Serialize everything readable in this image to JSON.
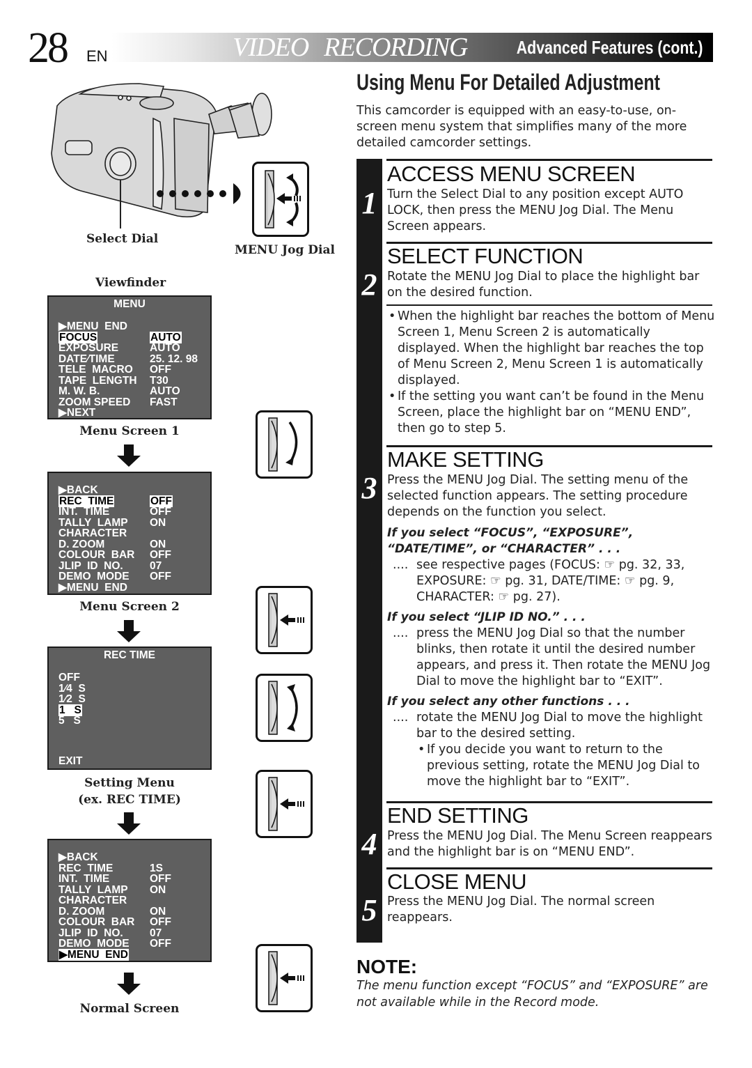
{
  "header": {
    "page_number": "28",
    "language": "EN",
    "title_part1": "VIDEO",
    "title_part2": "RECORDING",
    "title_part3": "Advanced Features (cont.)"
  },
  "section": {
    "title": "Using Menu For Detailed Adjustment",
    "intro": "This camcorder is equipped with an easy-to-use, on-screen menu system that simplifies many of the more detailed camcorder settings."
  },
  "illustration": {
    "select_dial_label": "Select Dial",
    "menu_jog_dial_label": "MENU Jog Dial",
    "viewfinder_label": "Viewfinder"
  },
  "menu_screen_1": {
    "title": "MENU",
    "caption": "Menu Screen 1",
    "rows": [
      {
        "label": "▶MENU  END",
        "value": ""
      },
      {
        "label": "FOCUS",
        "value": "AUTO",
        "highlight": true
      },
      {
        "label": "EXPOSURE",
        "value": "AUTO"
      },
      {
        "label": "DATE∕TIME",
        "value": "25. 12. 98"
      },
      {
        "label": "TELE  MACRO",
        "value": "OFF"
      },
      {
        "label": "TAPE  LENGTH",
        "value": "T30"
      },
      {
        "label": "M. W. B.",
        "value": "AUTO"
      },
      {
        "label": "ZOOM SPEED",
        "value": "FAST"
      },
      {
        "label": "▶NEXT",
        "value": ""
      }
    ]
  },
  "menu_screen_2": {
    "caption": "Menu Screen 2",
    "rows": [
      {
        "label": "▶BACK",
        "value": ""
      },
      {
        "label": "REC  TIME",
        "value": "OFF",
        "highlight": true
      },
      {
        "label": "INT.  TIME",
        "value": "OFF"
      },
      {
        "label": "TALLY  LAMP",
        "value": "ON"
      },
      {
        "label": "CHARACTER",
        "value": ""
      },
      {
        "label": "D. ZOOM",
        "value": "ON"
      },
      {
        "label": "COLOUR  BAR",
        "value": "OFF"
      },
      {
        "label": "JLIP  ID  NO.",
        "value": "07"
      },
      {
        "label": "DEMO  MODE",
        "value": "OFF"
      },
      {
        "label": "▶MENU  END",
        "value": ""
      }
    ]
  },
  "setting_menu": {
    "title": "REC  TIME",
    "caption_line1": "Setting Menu",
    "caption_line2": "(ex. REC TIME)",
    "options": [
      "OFF",
      "1∕4  S",
      "1∕2  S",
      "1   S",
      "5   S"
    ],
    "selected_index": 3,
    "exit_label": "EXIT"
  },
  "menu_screen_final": {
    "rows": [
      {
        "label": "▶BACK",
        "value": ""
      },
      {
        "label": "REC  TIME",
        "value": "1S"
      },
      {
        "label": "INT.  TIME",
        "value": "OFF"
      },
      {
        "label": "TALLY  LAMP",
        "value": "ON"
      },
      {
        "label": "CHARACTER",
        "value": ""
      },
      {
        "label": "D. ZOOM",
        "value": "ON"
      },
      {
        "label": "COLOUR  BAR",
        "value": "OFF"
      },
      {
        "label": "JLIP  ID  NO.",
        "value": "07"
      },
      {
        "label": "DEMO  MODE",
        "value": "OFF"
      },
      {
        "label": "▶MENU  END",
        "value": "",
        "highlight": true
      }
    ],
    "caption": "Normal Screen"
  },
  "steps": [
    {
      "number": "1",
      "heading": "ACCESS MENU SCREEN",
      "body": "Turn the Select Dial to any position except AUTO LOCK, then press the MENU Jog Dial. The Menu Screen appears."
    },
    {
      "number": "2",
      "heading": "SELECT FUNCTION",
      "body": "Rotate the MENU Jog Dial to place the highlight bar on the desired function.",
      "bullets": [
        "When the highlight bar reaches the bottom of Menu Screen 1, Menu Screen 2 is automatically displayed. When the highlight bar reaches the top of Menu Screen 2, Menu Screen 1 is automatically displayed.",
        "If the setting you want can’t be found in the Menu Screen, place the highlight bar on “MENU END”, then go to step 5."
      ]
    },
    {
      "number": "3",
      "heading": "MAKE SETTING",
      "body": "Press the MENU Jog Dial. The setting menu of the selected function appears. The setting procedure depends on the function you select.",
      "cases": [
        {
          "heading": "If you select “FOCUS”, “EXPOSURE”, “DATE/TIME”, or “CHARACTER” . . .",
          "body": "see respective pages (FOCUS: ☞ pg. 32, 33, EXPOSURE: ☞ pg. 31, DATE/TIME: ☞ pg. 9, CHARACTER: ☞ pg. 27)."
        },
        {
          "heading": "If you select “JLIP ID NO.” . . .",
          "body": "press the MENU Jog Dial so that the number blinks, then rotate it until the desired number appears, and press it. Then rotate the MENU Jog Dial to move the highlight bar to “EXIT”."
        },
        {
          "heading": "If you select any other functions . . .",
          "body": "rotate the MENU Jog Dial to move the highlight bar to the desired setting.",
          "sub_bullet": "If you decide you want to return to the previous setting, rotate the MENU Jog Dial to move the highlight bar to “EXIT”."
        }
      ],
      "case_prefix": "...."
    },
    {
      "number": "4",
      "heading": "END SETTING",
      "body": "Press the MENU Jog Dial. The Menu Screen reappears and the highlight bar is on “MENU END”."
    },
    {
      "number": "5",
      "heading": "CLOSE MENU",
      "body": "Press the MENU Jog Dial. The normal screen reappears."
    }
  ],
  "note": {
    "title": "NOTE:",
    "text": "The menu function except “FOCUS” and “EXPOSURE” are not available while in the Record mode."
  }
}
